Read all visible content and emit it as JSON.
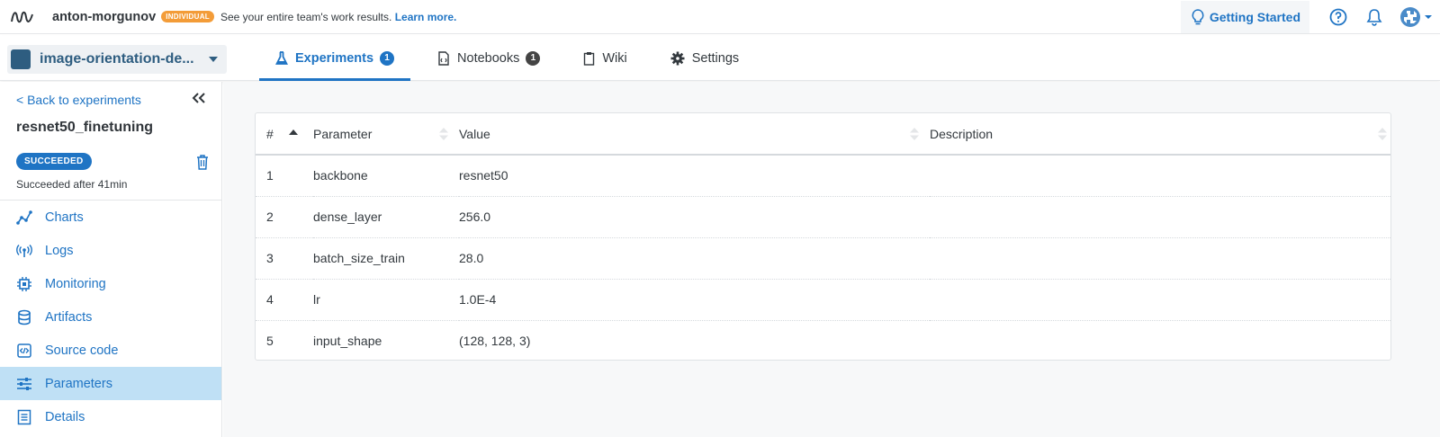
{
  "topbar": {
    "org_name": "anton-morgunov",
    "plan_badge": "INDIVIDUAL",
    "team_message": "See your entire team's work results.",
    "learn_more": "Learn more.",
    "getting_started": "Getting Started",
    "icons": [
      "neptune-logo-icon",
      "lightbulb-icon",
      "help-icon",
      "bell-icon",
      "avatar",
      "chevron-down-icon"
    ]
  },
  "project": {
    "name": "image-orientation-de..."
  },
  "tabs": [
    {
      "label": "Experiments",
      "count": "1",
      "active": true,
      "icon": "flask-icon"
    },
    {
      "label": "Notebooks",
      "count": "1",
      "active": false,
      "icon": "notebook-icon"
    },
    {
      "label": "Wiki",
      "active": false,
      "icon": "clipboard-icon"
    },
    {
      "label": "Settings",
      "active": false,
      "icon": "gear-icon"
    }
  ],
  "sidebar": {
    "back_link": "< Back to experiments",
    "experiment_name": "resnet50_finetuning",
    "status": "SUCCEEDED",
    "status_text": "Succeeded after 41min",
    "items": [
      {
        "label": "Charts",
        "icon": "chart-icon",
        "active": false
      },
      {
        "label": "Logs",
        "icon": "antenna-icon",
        "active": false
      },
      {
        "label": "Monitoring",
        "icon": "chip-icon",
        "active": false
      },
      {
        "label": "Artifacts",
        "icon": "database-icon",
        "active": false
      },
      {
        "label": "Source code",
        "icon": "code-file-icon",
        "active": false
      },
      {
        "label": "Parameters",
        "icon": "sliders-icon",
        "active": true
      },
      {
        "label": "Details",
        "icon": "list-icon",
        "active": false
      }
    ]
  },
  "parameters_table": {
    "headers": {
      "num": "#",
      "parameter": "Parameter",
      "value": "Value",
      "description": "Description"
    },
    "rows": [
      {
        "num": "1",
        "parameter": "backbone",
        "value": "resnet50",
        "description": ""
      },
      {
        "num": "2",
        "parameter": "dense_layer",
        "value": "256.0",
        "description": ""
      },
      {
        "num": "3",
        "parameter": "batch_size_train",
        "value": "28.0",
        "description": ""
      },
      {
        "num": "4",
        "parameter": "lr",
        "value": "1.0E-4",
        "description": ""
      },
      {
        "num": "5",
        "parameter": "input_shape",
        "value": "(128, 128, 3)",
        "description": ""
      }
    ]
  },
  "colors": {
    "accent": "#1f74c4",
    "badge_orange": "#f39c38",
    "active_nav_bg": "#bfe0f5",
    "project_square": "#2e5d80"
  }
}
